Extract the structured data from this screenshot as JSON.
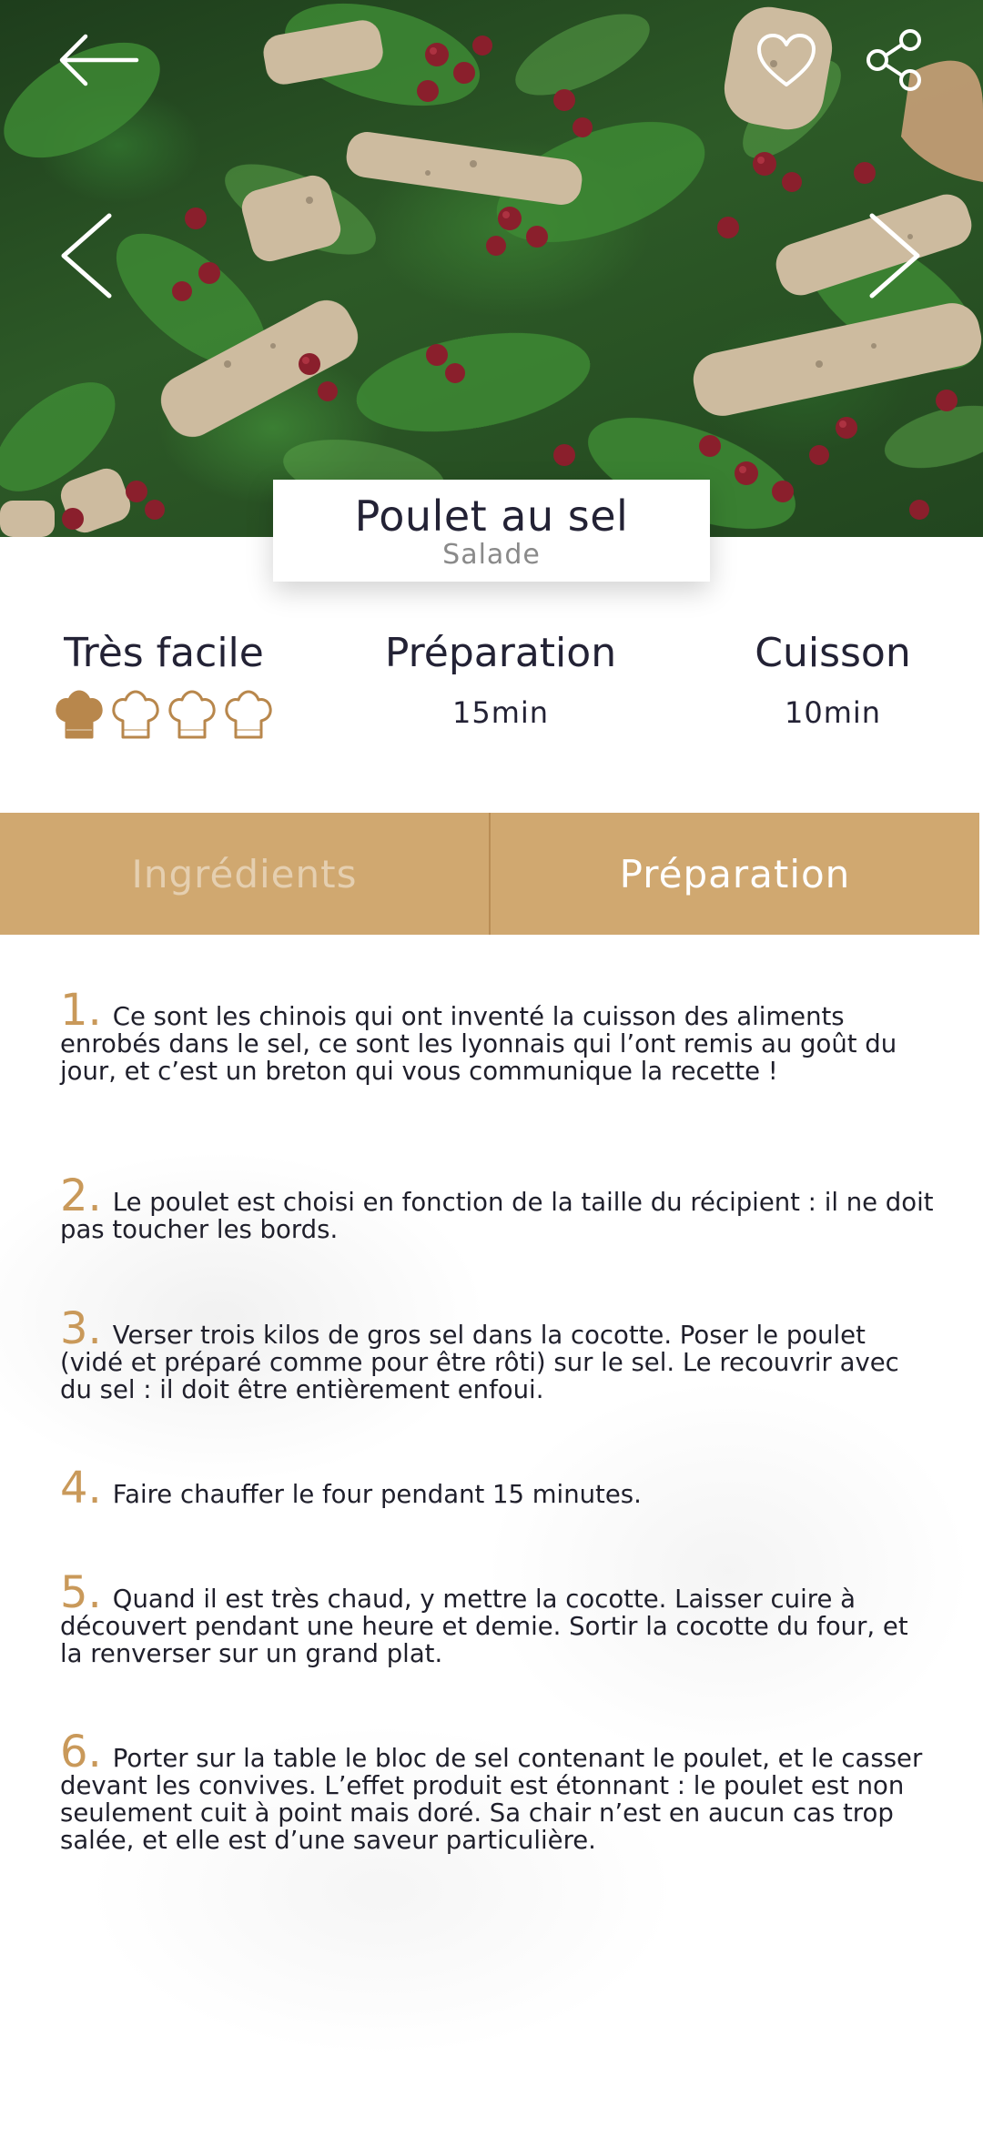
{
  "recipe": {
    "title": "Poulet au sel",
    "category": "Salade"
  },
  "info": {
    "difficulty": {
      "label": "Très facile",
      "level": 1,
      "max": 4
    },
    "preparation": {
      "label": "Préparation",
      "value": "15min"
    },
    "cooking": {
      "label": "Cuisson",
      "value": "10min"
    }
  },
  "tabs": [
    {
      "label": "Ingrédients",
      "active": false
    },
    {
      "label": "Préparation",
      "active": true
    }
  ],
  "steps": [
    {
      "num": "1.",
      "text": "Ce sont les chinois qui ont inventé la cuisson des aliments enrobés dans le sel, ce sont les lyonnais qui l’ont remis au goût du jour, et c’est un breton qui vous communique la recette !"
    },
    {
      "num": "2.",
      "text": "Le poulet est choisi en fonction de la taille du récipient : il ne doit pas toucher les bords."
    },
    {
      "num": "3.",
      "text": "Verser trois kilos de gros sel dans la cocotte. Poser le poulet (vidé et préparé comme pour être rôti) sur le sel. Le recouvrir avec du sel : il doit être entièrement enfoui."
    },
    {
      "num": "4.",
      "text": "Faire chauffer le four pendant 15 minutes."
    },
    {
      "num": "5.",
      "text": "Quand il est très chaud, y mettre la cocotte. Laisser cuire à découvert pendant une heure et demie. Sortir la cocotte du four, et la renverser sur un grand plat."
    },
    {
      "num": "6.",
      "text": "Porter sur la table le bloc de sel contenant le poulet, et le casser devant les convives. L’effet produit est étonnant : le poulet est non seulement cuit à point mais doré. Sa chair n’est en aucun cas trop salée, et elle est d’une saveur particulière."
    }
  ],
  "icons": {
    "back": "arrow-left-icon",
    "favorite": "heart-icon",
    "share": "share-icon",
    "prev": "chevron-left-icon",
    "next": "chevron-right-icon",
    "difficulty": "chef-hat-icon"
  },
  "colors": {
    "accent": "#d0a870",
    "step_number": "#c9995a",
    "text": "#1f1f2b"
  }
}
